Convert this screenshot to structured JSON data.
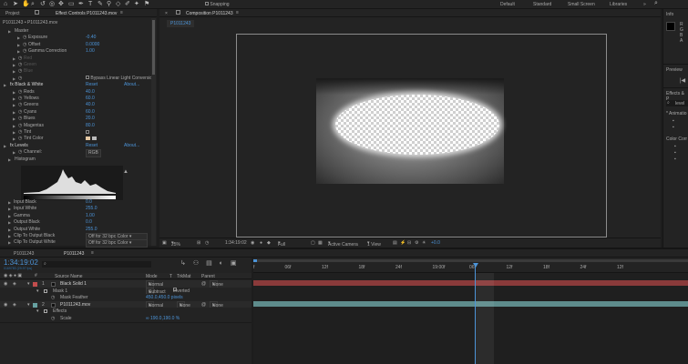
{
  "toolbar": {
    "snapping_label": "Snapping",
    "workspaces": [
      "Default",
      "Standard",
      "Small Screen",
      "Libraries"
    ],
    "active_workspace": "Standard",
    "info_label": "Info"
  },
  "project_tab": "Project",
  "effect_controls": {
    "tab": "Effect Controls P1011243.mov",
    "path": "P1011243 • P1011243.mov",
    "rows": [
      {
        "label": "Master",
        "indent": 1
      },
      {
        "label": "Exposure",
        "value": "-0.40",
        "indent": 3
      },
      {
        "label": "Offset",
        "value": "0.0000",
        "indent": 3
      },
      {
        "label": "Gamma Correction",
        "value": "1.00",
        "indent": 3
      },
      {
        "label": "Red",
        "indent": 2,
        "dim": true
      },
      {
        "label": "Green",
        "indent": 2,
        "dim": true
      },
      {
        "label": "Blue",
        "indent": 2,
        "dim": true
      },
      {
        "label": "",
        "indent": 2,
        "check": "Bypass Linear Light Conversion"
      },
      {
        "label": "fx  Black & White",
        "reset": "Reset",
        "about": "About...",
        "indent": 0
      },
      {
        "label": "Reds",
        "value": "40.0",
        "indent": 2
      },
      {
        "label": "Yellows",
        "value": "60.0",
        "indent": 2
      },
      {
        "label": "Greens",
        "value": "40.0",
        "indent": 2
      },
      {
        "label": "Cyans",
        "value": "60.0",
        "indent": 2
      },
      {
        "label": "Blues",
        "value": "20.0",
        "indent": 2
      },
      {
        "label": "Magentas",
        "value": "80.0",
        "indent": 2
      },
      {
        "label": "Tint",
        "indent": 2,
        "box": true
      },
      {
        "label": "Tint Color",
        "indent": 2,
        "swatch": true
      },
      {
        "label": "fx  Levels",
        "reset": "Reset",
        "about": "About...",
        "indent": 0
      },
      {
        "label": "Channel:",
        "indent": 2,
        "dropdown": "RGB"
      },
      {
        "label": "Histogram",
        "indent": 1
      }
    ],
    "lower_rows": [
      {
        "label": "Input Black",
        "value": "0.0"
      },
      {
        "label": "Input White",
        "value": "255.0"
      },
      {
        "label": "Gamma",
        "value": "1.00"
      },
      {
        "label": "Output Black",
        "value": "0.0"
      },
      {
        "label": "Output White",
        "value": "255.0"
      },
      {
        "label": "Clip To Output Black",
        "dropdown": "Off for 32 bpc Color"
      },
      {
        "label": "Clip To Output White",
        "dropdown": "Off for 32 bpc Color"
      }
    ]
  },
  "composition": {
    "tab": "Composition P1011243",
    "subtab": "P1011243",
    "zoom": "25%",
    "timecode": "1:34:19:02",
    "resolution": "Full",
    "camera": "Active Camera",
    "views": "1 View",
    "exposure": "+0.0"
  },
  "right_panel": {
    "info_tab": "Info",
    "preview_tab": "Preview",
    "effects_tab": "Effects & P",
    "search": "level",
    "items": [
      "* Animatio",
      "Color Corr"
    ]
  },
  "timeline": {
    "tabs": [
      "P1011243",
      "P1011243"
    ],
    "timecode": "1:34:19:02",
    "frame_info": "0169783 (29.97 fps)",
    "columns": {
      "source": "Source Name",
      "mode": "Mode",
      "t": "T",
      "trkmat": "TrkMat",
      "parent": "Parent"
    },
    "ruler": [
      "f",
      "06f",
      "12f",
      "18f",
      "24f",
      "19:00f",
      "06f",
      "12f",
      "18f",
      "24f",
      "12f"
    ],
    "layers": [
      {
        "num": "1",
        "name": "Black Solid 1",
        "mode": "Normal",
        "parent": "None",
        "color": "#c24d4d"
      },
      {
        "name": "Mask 1",
        "mode": "Subtract",
        "extra": "Inverted",
        "sub": true
      },
      {
        "name": "Mask Feather",
        "value": "450.0,450.0 pixels",
        "sub2": true
      },
      {
        "num": "2",
        "name": "P1011243.mov",
        "mode": "Normal",
        "trk": "None",
        "parent": "None",
        "color": "#67a1a1"
      },
      {
        "name": "Effects",
        "sub": true
      },
      {
        "name": "Scale",
        "value": "∞ 190.0,190.0 %",
        "sub2": true
      }
    ]
  }
}
